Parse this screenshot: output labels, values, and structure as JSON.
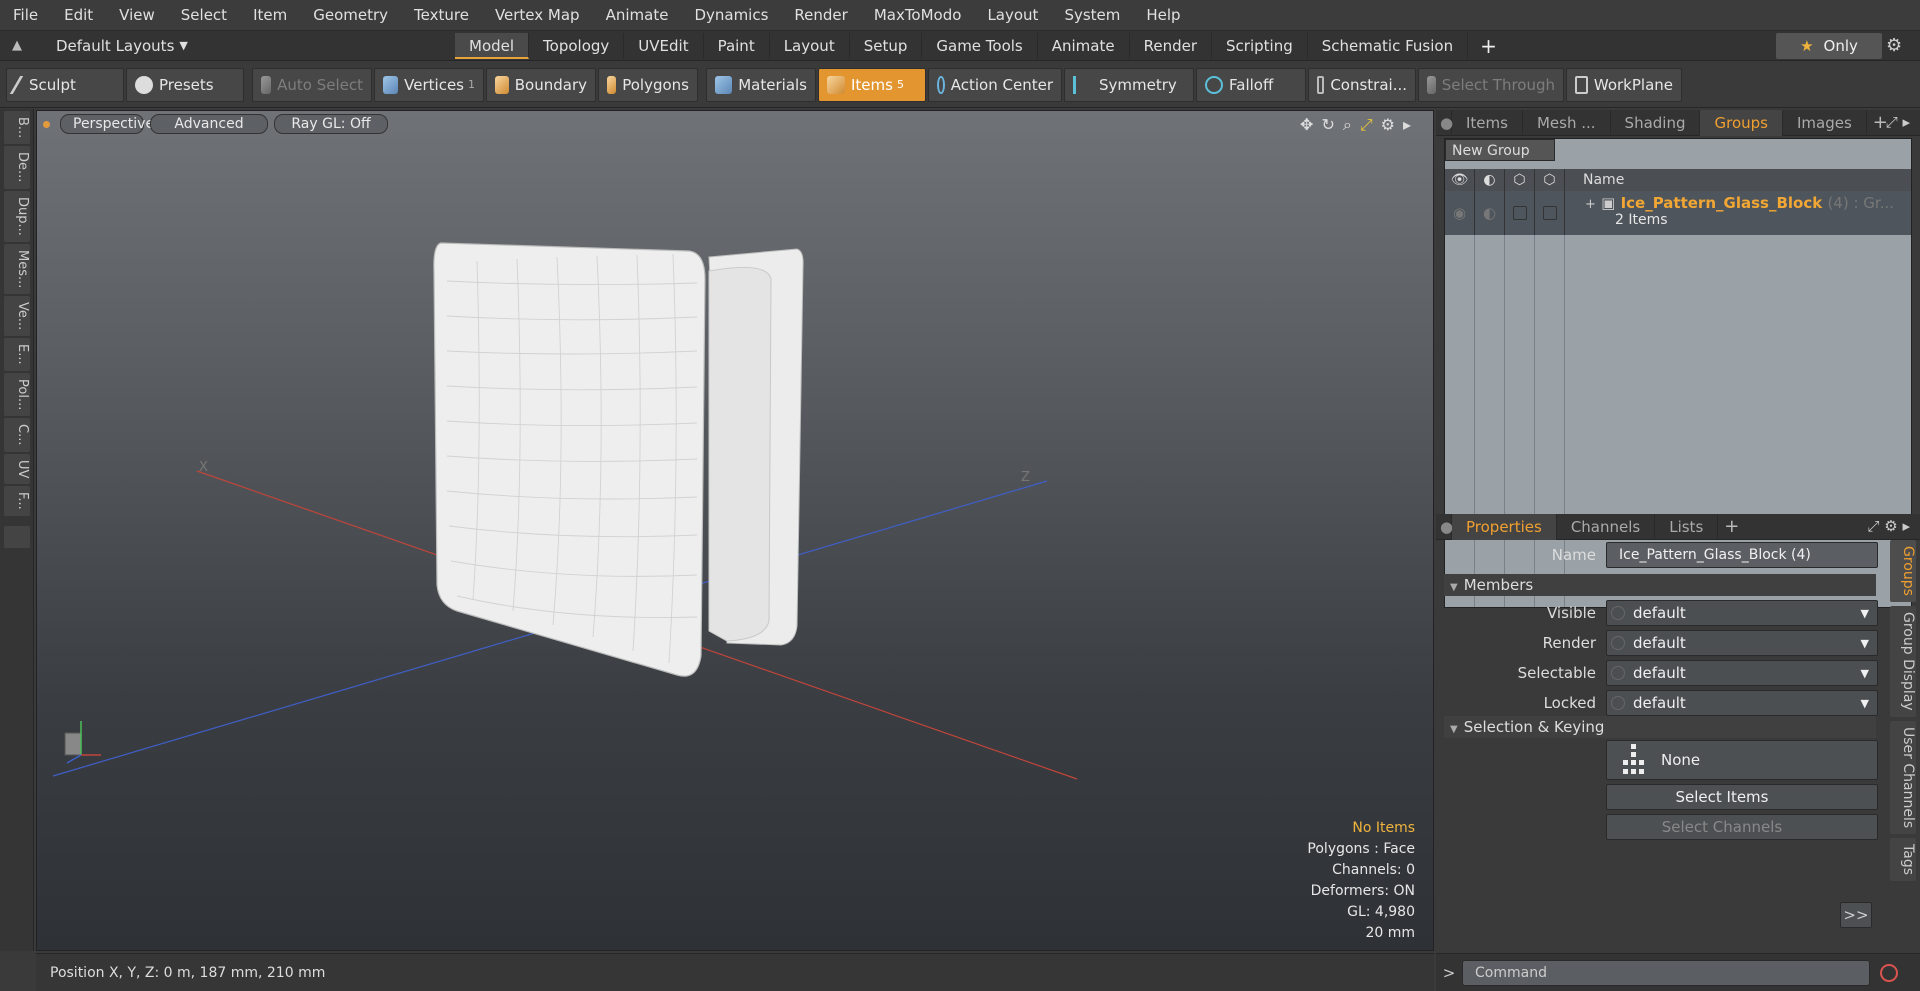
{
  "menu": [
    "File",
    "Edit",
    "View",
    "Select",
    "Item",
    "Geometry",
    "Texture",
    "Vertex Map",
    "Animate",
    "Dynamics",
    "Render",
    "MaxToModo",
    "Layout",
    "System",
    "Help"
  ],
  "layouts_label": "Default Layouts",
  "layout_tabs": [
    "Model",
    "Topology",
    "UVEdit",
    "Paint",
    "Layout",
    "Setup",
    "Game Tools",
    "Animate",
    "Render",
    "Scripting",
    "Schematic Fusion"
  ],
  "active_layout_tab": "Model",
  "only_label": "Only",
  "toolbar": {
    "sculpt": "Sculpt",
    "presets": "Presets",
    "auto_select": "Auto Select",
    "vertices": "Vertices",
    "vertices_count": "1",
    "boundary": "Boundary",
    "polygons": "Polygons",
    "materials": "Materials",
    "items": "Items",
    "items_count": "5",
    "action_center": "Action Center",
    "symmetry": "Symmetry",
    "falloff": "Falloff",
    "constraints": "Constrai...",
    "select_through": "Select Through",
    "workplane": "WorkPlane"
  },
  "left_tabs": [
    "B...",
    "De...",
    "Dup...",
    "Mes...",
    "Ve...",
    "E...",
    "Pol...",
    "C...",
    "UV",
    "F..."
  ],
  "viewport": {
    "perspective": "Perspective",
    "advanced": "Advanced",
    "raygl": "Ray GL: Off",
    "axis_x": "X",
    "axis_z": "Z",
    "info": {
      "no_items": "No Items",
      "polygons": "Polygons : Face",
      "channels": "Channels: 0",
      "deformers": "Deformers: ON",
      "gl": "GL: 4,980",
      "scale": "20 mm"
    }
  },
  "status": {
    "position": "Position X, Y, Z:   0 m, 187 mm, 210 mm"
  },
  "panel_tabs": [
    "Items",
    "Mesh ...",
    "Shading",
    "Groups",
    "Images"
  ],
  "active_panel_tab": "Groups",
  "groups": {
    "new_group": "New Group",
    "name_header": "Name",
    "group_name": "Ice_Pattern_Glass_Block",
    "group_suffix": "(4) : Gr...",
    "group_items": "2 Items"
  },
  "props_tabs": [
    "Properties",
    "Channels",
    "Lists"
  ],
  "properties": {
    "name_label": "Name",
    "name_value": "Ice_Pattern_Glass_Block (4)",
    "members_section": "Members",
    "visible_label": "Visible",
    "visible_value": "default",
    "render_label": "Render",
    "render_value": "default",
    "selectable_label": "Selectable",
    "selectable_value": "default",
    "locked_label": "Locked",
    "locked_value": "default",
    "selection_section": "Selection & Keying",
    "none_label": "None",
    "select_items": "Select Items",
    "select_channels": "Select Channels",
    "expand": ">>"
  },
  "right_vtabs": [
    "Groups",
    "Group Display",
    "User Channels",
    "Tags"
  ],
  "command_placeholder": "Command"
}
